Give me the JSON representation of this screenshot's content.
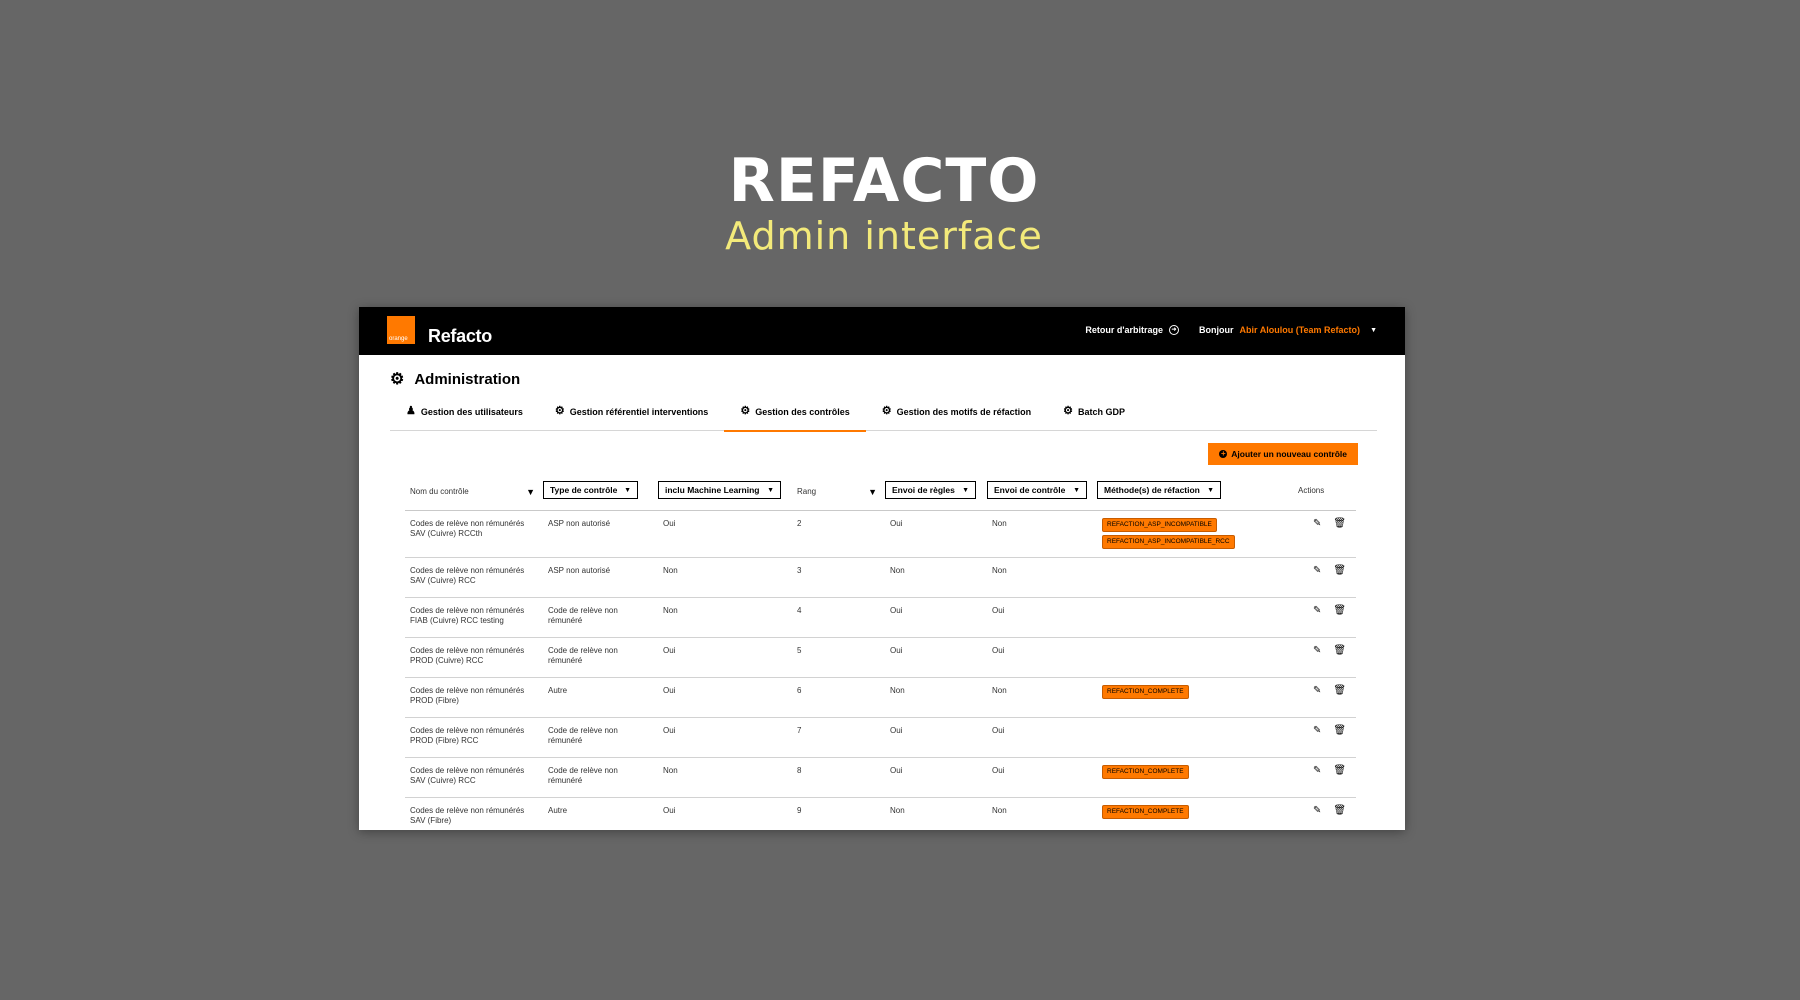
{
  "hero": {
    "title": "REFACTO",
    "subtitle": "Admin interface"
  },
  "app": {
    "logo_text": "orange",
    "name": "Refacto",
    "back_link": "Retour d'arbitrage",
    "greeting": "Bonjour",
    "user": "Abir Aloulou (Team Refacto)"
  },
  "page_title": "Administration",
  "tabs": [
    {
      "label": "Gestion des utilisateurs",
      "icon": "user-icon"
    },
    {
      "label": "Gestion référentiel interventions",
      "icon": "gear-icon"
    },
    {
      "label": "Gestion des contrôles",
      "icon": "gear-icon",
      "active": true
    },
    {
      "label": "Gestion des motifs de réfaction",
      "icon": "gear-icon"
    },
    {
      "label": "Batch GDP",
      "icon": "gear-icon"
    }
  ],
  "add_button": "Ajouter un nouveau contrôle",
  "columns": {
    "nom": "Nom du contrôle",
    "type": "Type de contrôle",
    "ml": "inclu Machine Learning",
    "rang": "Rang",
    "regles": "Envoi de règles",
    "envoi": "Envoi de contrôle",
    "methodes": "Méthode(s) de réfaction",
    "actions": "Actions"
  },
  "rows": [
    {
      "nom1": "Codes de relève non rémunérés",
      "nom2": "SAV (Cuivre) RCCth",
      "type1": "ASP non autorisé",
      "type2": "",
      "ml": "Oui",
      "rang": "2",
      "regles": "Oui",
      "envoi": "Non",
      "badges": [
        "REFACTION_ASP_INCOMPATIBLE",
        "REFACTION_ASP_INCOMPATIBLE_RCC"
      ]
    },
    {
      "nom1": "Codes de relève non rémunérés",
      "nom2": "SAV (Cuivre) RCC",
      "type1": "ASP non autorisé",
      "type2": "",
      "ml": "Non",
      "rang": "3",
      "regles": "Non",
      "envoi": "Non",
      "badges": []
    },
    {
      "nom1": "Codes de relève non rémunérés",
      "nom2": "FIAB (Cuivre) RCC testing",
      "type1": "Code de relève non",
      "type2": "rémunéré",
      "ml": "Non",
      "rang": "4",
      "regles": "Oui",
      "envoi": "Oui",
      "badges": []
    },
    {
      "nom1": "Codes de relève non rémunérés",
      "nom2": "PROD (Cuivre) RCC",
      "type1": "Code de relève non",
      "type2": "rémunéré",
      "ml": "Oui",
      "rang": "5",
      "regles": "Oui",
      "envoi": "Oui",
      "badges": []
    },
    {
      "nom1": "Codes de relève non rémunérés",
      "nom2": "PROD (Fibre)",
      "type1": "Autre",
      "type2": "",
      "ml": "Oui",
      "rang": "6",
      "regles": "Non",
      "envoi": "Non",
      "badges": [
        "REFACTION_COMPLETE"
      ]
    },
    {
      "nom1": "Codes de relève non rémunérés",
      "nom2": "PROD (Fibre) RCC",
      "type1": "Code de relève non",
      "type2": "rémunéré",
      "ml": "Oui",
      "rang": "7",
      "regles": "Oui",
      "envoi": "Oui",
      "badges": []
    },
    {
      "nom1": "Codes de relève non rémunérés",
      "nom2": "SAV (Cuivre) RCC",
      "type1": "Code de relève non",
      "type2": "rémunéré",
      "ml": "Non",
      "rang": "8",
      "regles": "Oui",
      "envoi": "Oui",
      "badges": [
        "REFACTION_COMPLETE"
      ]
    },
    {
      "nom1": "Codes de relève non rémunérés",
      "nom2": "SAV (Fibre)",
      "type1": "Autre",
      "type2": "",
      "ml": "Oui",
      "rang": "9",
      "regles": "Non",
      "envoi": "Non",
      "badges": [
        "REFACTION_COMPLETE"
      ]
    }
  ],
  "colors": {
    "accent": "#ff7900",
    "topbar": "#000000",
    "background": "#666666",
    "subtitle": "#f3ea7a"
  }
}
